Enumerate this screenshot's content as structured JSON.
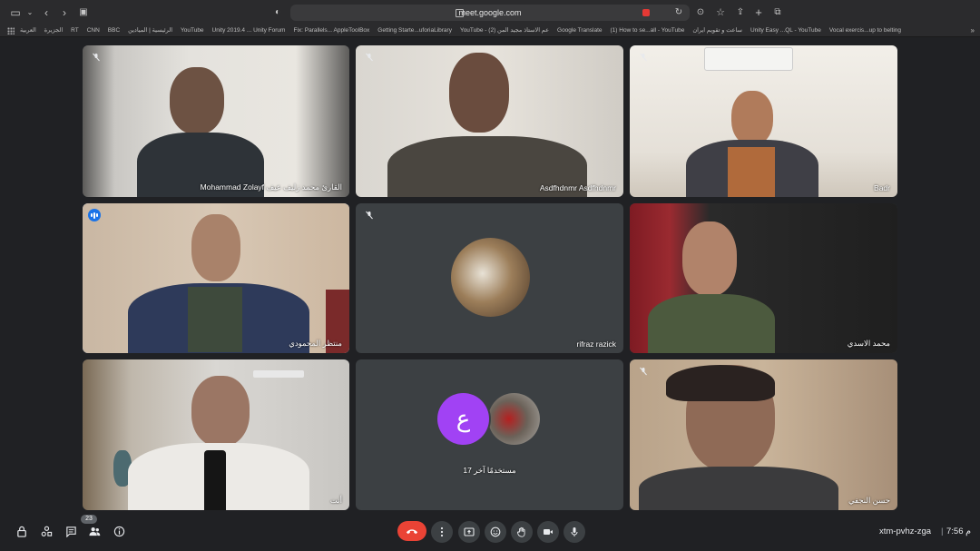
{
  "browser": {
    "url": "meet.google.com",
    "bookmarks": [
      "العربية",
      "الجزيرة",
      "RT",
      "CNN",
      "BBC",
      "الرئيسية | الميادين",
      "YouTube",
      "Unity 2019.4 ... Unity Forum",
      "Fix: Parallels... AppleToolBox",
      "Getting Starte...uforiaLibrary",
      "YouTube - عم الاستاذ مجيد المن (2)",
      "Google Translate",
      "(1) How to se...all - YouTube",
      "ساعت و تقويم ايران",
      "Unity Easy ...QL - YouTube",
      "Vocal exercis...up to belting"
    ],
    "more": "»"
  },
  "participants": [
    {
      "name": "Mohammad Zolayf القارئ محمد زليف عيف",
      "muted": true
    },
    {
      "name": "Asdfhdnmr Asdfhdnmr",
      "muted": true
    },
    {
      "name": "Badr",
      "muted": true
    },
    {
      "name": "منتظر المحمودي",
      "muted": false,
      "speaking": true
    },
    {
      "name": "rifraz razick",
      "muted": true
    },
    {
      "name": "محمد الاسدي",
      "muted": false
    },
    {
      "name": "أنت",
      "muted": false
    },
    {
      "name": "17 مستخدمًا آخر",
      "muted": false,
      "avatar_letter": "ع"
    },
    {
      "name": "حسن النجفي",
      "muted": true
    }
  ],
  "controls": {
    "participants_count": "23",
    "meeting_code": "xtm-pvhz-zga",
    "separator": "|",
    "time": "7:56 م"
  },
  "colors": {
    "background": "#202124",
    "tile": "#3c4043",
    "end_call": "#ea4335",
    "speaking": "#1a73e8",
    "avatar_purple": "#a142f4"
  }
}
